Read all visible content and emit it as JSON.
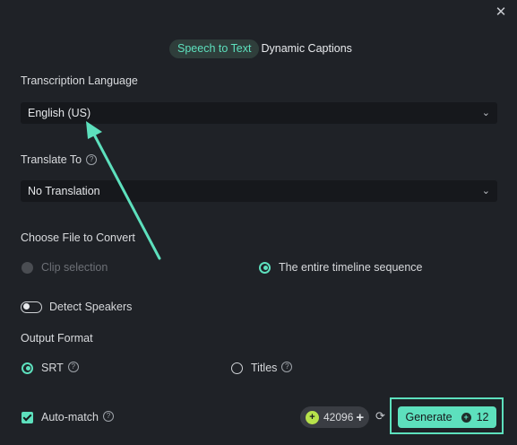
{
  "dialog": {
    "close_symbol": "✕"
  },
  "tabs": [
    {
      "label": "Speech to Text",
      "active": true
    },
    {
      "label": "Dynamic Captions",
      "active": false
    }
  ],
  "transcription": {
    "label": "Transcription Language",
    "value": "English (US)"
  },
  "translate": {
    "label": "Translate To",
    "value": "No Translation"
  },
  "file": {
    "label": "Choose File to Convert",
    "options": [
      {
        "label": "Clip selection",
        "selected": false,
        "disabled": true
      },
      {
        "label": "The entire timeline sequence",
        "selected": true,
        "disabled": false
      }
    ]
  },
  "detect": {
    "label": "Detect Speakers",
    "enabled": false
  },
  "output": {
    "label": "Output Format",
    "options": [
      {
        "label": "SRT",
        "selected": true
      },
      {
        "label": "Titles",
        "selected": false
      }
    ]
  },
  "automatch": {
    "label": "Auto-match",
    "checked": true
  },
  "credits": {
    "value": "42096"
  },
  "generate": {
    "label": "Generate",
    "cost": "12"
  },
  "colors": {
    "accent": "#5de0bd",
    "background": "#1f2227",
    "field": "#16181c"
  },
  "icons": [
    "close-icon",
    "chevron-down-icon",
    "help-icon",
    "credit-icon",
    "plus-icon",
    "refresh-icon",
    "credit-cost-icon"
  ]
}
